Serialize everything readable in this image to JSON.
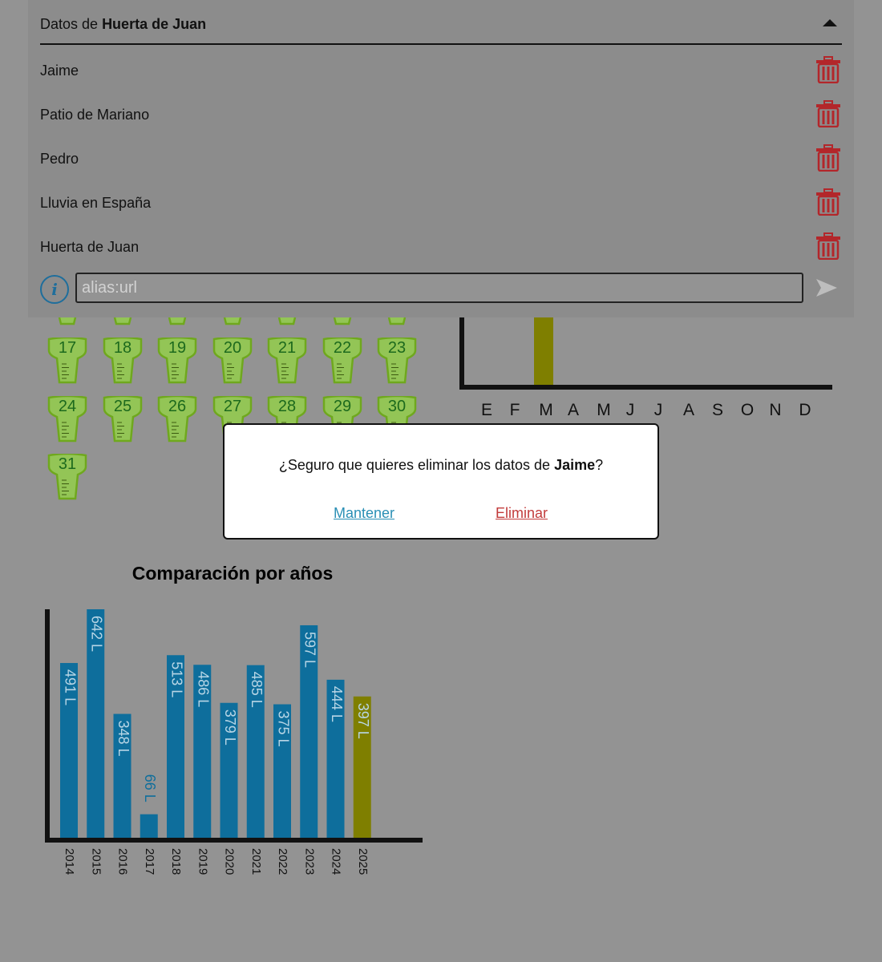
{
  "panel": {
    "title_prefix": "Datos de",
    "title_location": "Huerta de Juan",
    "locations": [
      {
        "name": "Jaime"
      },
      {
        "name": "Patio de Mariano"
      },
      {
        "name": "Pedro"
      },
      {
        "name": "Lluvia en España"
      },
      {
        "name": "Huerta de Juan"
      }
    ],
    "input_placeholder": "alias:url",
    "input_value": ""
  },
  "calendar": {
    "days": [
      "17",
      "18",
      "19",
      "20",
      "21",
      "22",
      "23",
      "24",
      "25",
      "26",
      "27",
      "28",
      "29",
      "30",
      "31"
    ],
    "gauge_color": "#6fa81e"
  },
  "monthly": {
    "months": [
      "E",
      "F",
      "M",
      "A",
      "M",
      "J",
      "J",
      "A",
      "S",
      "O",
      "N",
      "D"
    ],
    "highlight_color": "#7f7f00"
  },
  "years_chart": {
    "title": "Comparación por años",
    "chart_data": {
      "type": "bar",
      "title": "Comparación por años",
      "categories": [
        "2014",
        "2015",
        "2016",
        "2017",
        "2018",
        "2019",
        "2020",
        "2021",
        "2022",
        "2023",
        "2024",
        "2025"
      ],
      "values": [
        491,
        642,
        348,
        66,
        513,
        486,
        379,
        485,
        375,
        597,
        444,
        397
      ],
      "labels": [
        "491 L",
        "642 L",
        "348 L",
        "66 L",
        "513 L",
        "486 L",
        "379 L",
        "485 L",
        "375 L",
        "597 L",
        "444 L",
        "397 L"
      ],
      "unit": "L",
      "bar_color": "#0e6e9c",
      "highlight_color": "#7f7f00",
      "highlight_category": "2025"
    }
  },
  "dialog": {
    "message_prefix": "¿Seguro que quieres eliminar los datos de ",
    "message_name": "Jaime",
    "message_suffix": "?",
    "keep_label": "Mantener",
    "delete_label": "Eliminar"
  }
}
